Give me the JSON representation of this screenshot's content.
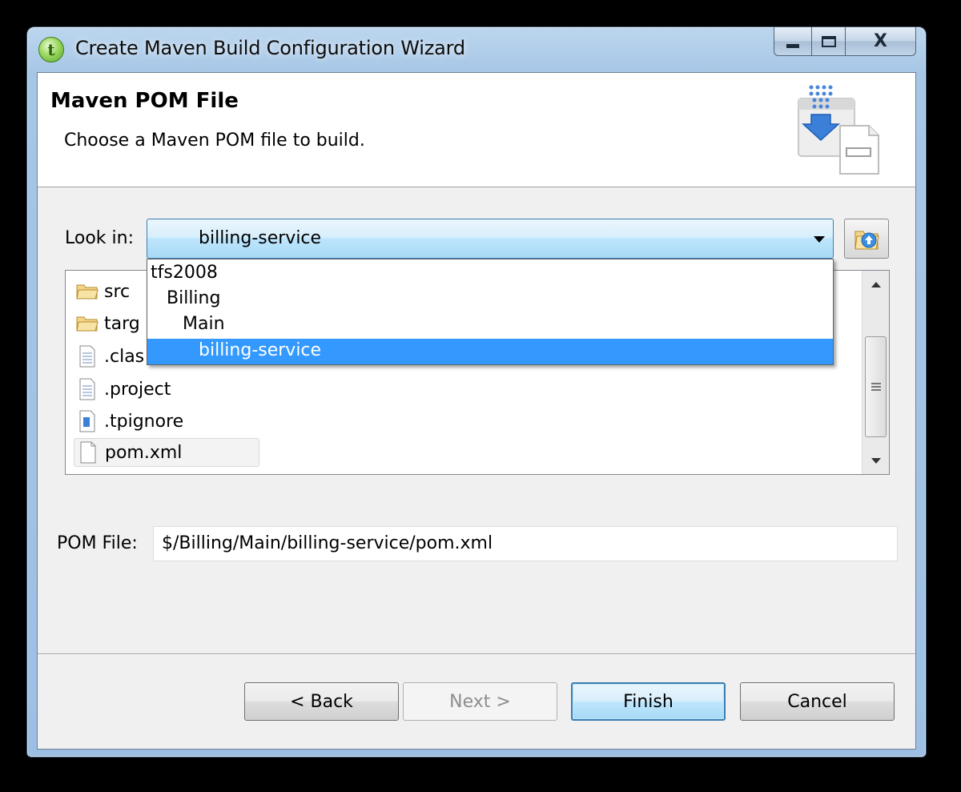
{
  "window": {
    "title": "Create Maven Build Configuration Wizard",
    "close_glyph": "X"
  },
  "banner": {
    "title": "Maven POM File",
    "subtitle": "Choose a Maven POM file to build."
  },
  "look_in": {
    "label": "Look in:",
    "selected": "billing-service",
    "options": [
      "tfs2008",
      "Billing",
      "Main",
      "billing-service"
    ]
  },
  "files": [
    {
      "name": "src",
      "icon": "folder-icon"
    },
    {
      "name": "targ",
      "icon": "folder-icon"
    },
    {
      "name": ".clas",
      "icon": "file-icon"
    },
    {
      "name": ".project",
      "icon": "file-icon"
    },
    {
      "name": ".tpignore",
      "icon": "ignore-file-icon"
    },
    {
      "name": "pom.xml",
      "icon": "xml-file-icon",
      "selected": true
    }
  ],
  "pom_file": {
    "label": "POM File:",
    "value": "$/Billing/Main/billing-service/pom.xml"
  },
  "buttons": {
    "back": "< Back",
    "next": "Next >",
    "finish": "Finish",
    "cancel": "Cancel"
  },
  "colors": {
    "highlight": "#3399ff",
    "accent_border": "#3c7fb1"
  }
}
